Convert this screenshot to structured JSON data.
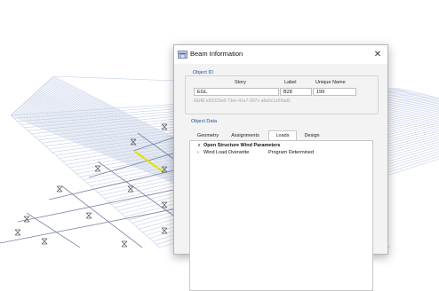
{
  "window": {
    "title": "Beam Information",
    "close_label": "✕"
  },
  "object_id": {
    "group_label": "Object ID",
    "headers": {
      "story": "Story",
      "label": "Label",
      "unique_name": "Unique Name"
    },
    "values": {
      "story": "EGL",
      "label": "B28",
      "unique_name": "199"
    },
    "guid_label": "GUID",
    "guid_value": "e55323e8-73ec-41e7-907c-a8a5c1e60ad2"
  },
  "object_data": {
    "group_label": "Object Data",
    "tabs": [
      "Geometry",
      "Assignments",
      "Loads",
      "Design"
    ],
    "active_tab": "Loads",
    "tree": [
      {
        "label": "Open Structure Wind Parameters",
        "expanded": true,
        "value": ""
      },
      {
        "label": "Wind Load Overwrite",
        "expanded": false,
        "value": "Program Determined"
      }
    ]
  },
  "colors": {
    "grid": "#c5cfe6",
    "frame": "#6e7896",
    "selected_beam": "#e6e100",
    "group_label": "#1f4fa3"
  },
  "icons": {
    "title": "beam-info-icon",
    "support": "fixed-support-icon"
  }
}
